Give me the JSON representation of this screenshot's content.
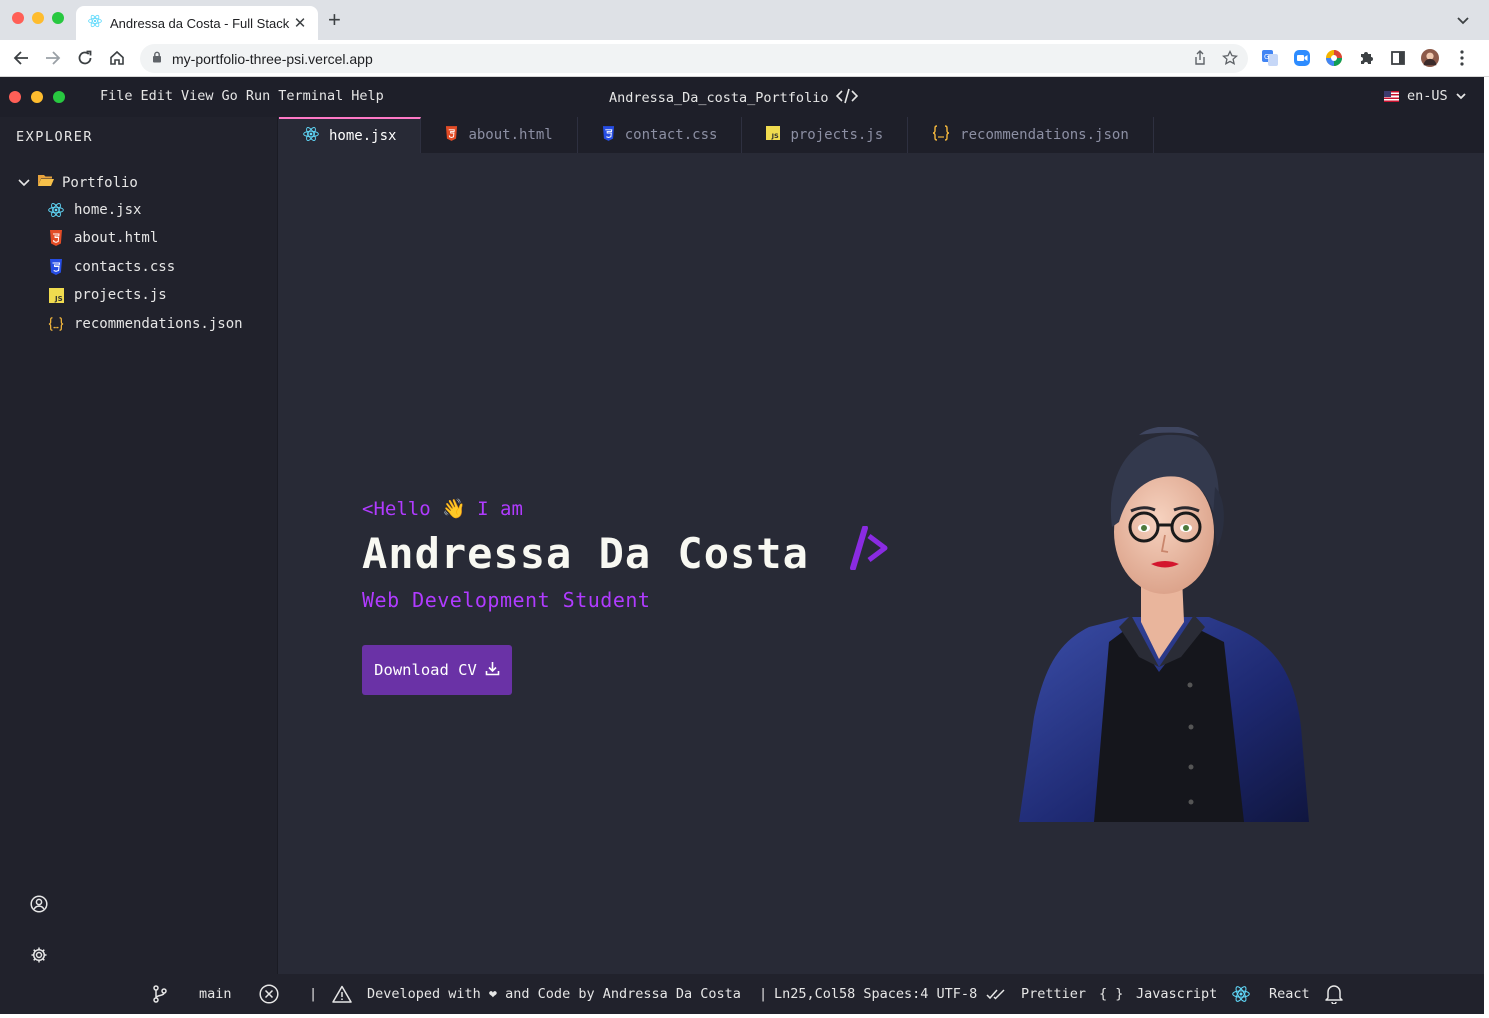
{
  "browser": {
    "tab_title": "Andressa da Costa - Full Stack Developer",
    "new_tab_symbol": "+",
    "close_symbol": "✕",
    "url": "my-portfolio-three-psi.vercel.app"
  },
  "app": {
    "menu": [
      "File",
      "Edit",
      "View",
      "Go",
      "Run",
      "Terminal",
      "Help"
    ],
    "window_title": "Andressa_Da_costa_Portfolio",
    "language": "en-US"
  },
  "sidebar": {
    "explorer_label": "EXPLORER",
    "folder_label": "Portfolio",
    "files": [
      {
        "label": "home.jsx",
        "icon": "react-icon"
      },
      {
        "label": "about.html",
        "icon": "html5-icon"
      },
      {
        "label": "contacts.css",
        "icon": "css3-icon"
      },
      {
        "label": "projects.js",
        "icon": "javascript-icon"
      },
      {
        "label": "recommendations.json",
        "icon": "json-icon"
      }
    ]
  },
  "tabs": [
    {
      "label": "home.jsx",
      "icon": "react-icon",
      "active": true
    },
    {
      "label": "about.html",
      "icon": "html5-icon",
      "active": false
    },
    {
      "label": "contact.css",
      "icon": "css3-icon",
      "active": false
    },
    {
      "label": "projects.js",
      "icon": "javascript-icon",
      "active": false
    },
    {
      "label": "recommendations.json",
      "icon": "json-icon",
      "active": false
    }
  ],
  "hero": {
    "greeting": "<Hello 👋 I am",
    "name": "Andressa Da Costa",
    "role": "Web Development Student",
    "download_label": "Download CV"
  },
  "statusbar": {
    "branch": "main",
    "message": "Developed with ❤ and Code by Andressa Da Costa",
    "position": "Ln25,Col58 Spaces:4 UTF-8",
    "prettier": "Prettier",
    "language": "Javascript",
    "framework": "React",
    "separator": "|",
    "braces": "{ }"
  },
  "colors": {
    "accent_purple": "#b03bff",
    "button_purple": "#6a32a6",
    "editor_bg": "#282a36",
    "sidebar_bg": "#21222c",
    "active_tab_border": "#ff79c6"
  }
}
